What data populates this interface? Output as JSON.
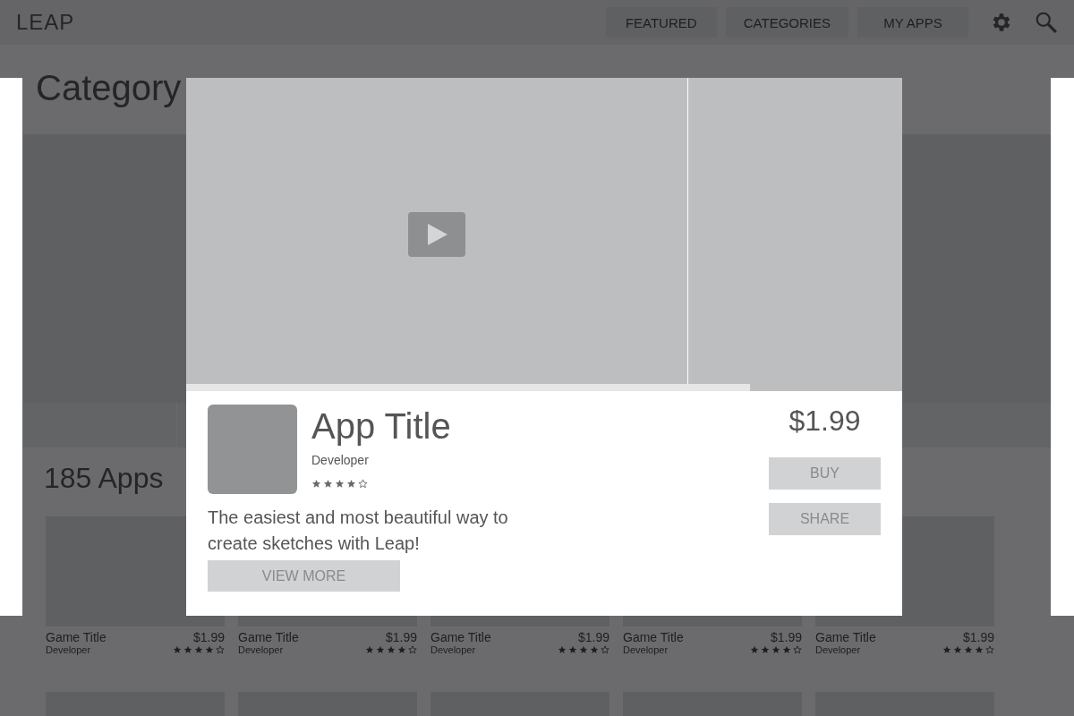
{
  "header": {
    "logo": "LEAP",
    "nav": [
      {
        "label": "FEATURED"
      },
      {
        "label": "CATEGORIES"
      },
      {
        "label": "MY APPS"
      }
    ]
  },
  "page": {
    "title": "Category",
    "count": "185 Apps",
    "games": [
      {
        "kind": "game",
        "title": "Game Title",
        "price": "$1.99",
        "developer": "Developer",
        "stars": 4
      },
      {
        "kind": "game",
        "title": "Game Title",
        "price": "$1.99",
        "developer": "Developer",
        "stars": 4
      },
      {
        "kind": "game",
        "title": "Game Title",
        "price": "$1.99",
        "developer": "Developer",
        "stars": 4
      },
      {
        "kind": "game",
        "title": "Game Title",
        "price": "$1.99",
        "developer": "Developer",
        "stars": 4
      },
      {
        "kind": "game",
        "title": "Game Title",
        "price": "$1.99",
        "developer": "Developer",
        "stars": 4
      },
      {
        "kind": "placeholder"
      },
      {
        "kind": "placeholder"
      },
      {
        "kind": "placeholder"
      },
      {
        "kind": "placeholder"
      },
      {
        "kind": "placeholder"
      }
    ]
  },
  "modal": {
    "title": "App Title",
    "developer": "Developer",
    "stars": 4,
    "price": "$1.99",
    "description": "The easiest and most beautiful way to create sketches with Leap!",
    "view_more": "VIEW MORE",
    "buy": "BUY",
    "share": "SHARE"
  }
}
